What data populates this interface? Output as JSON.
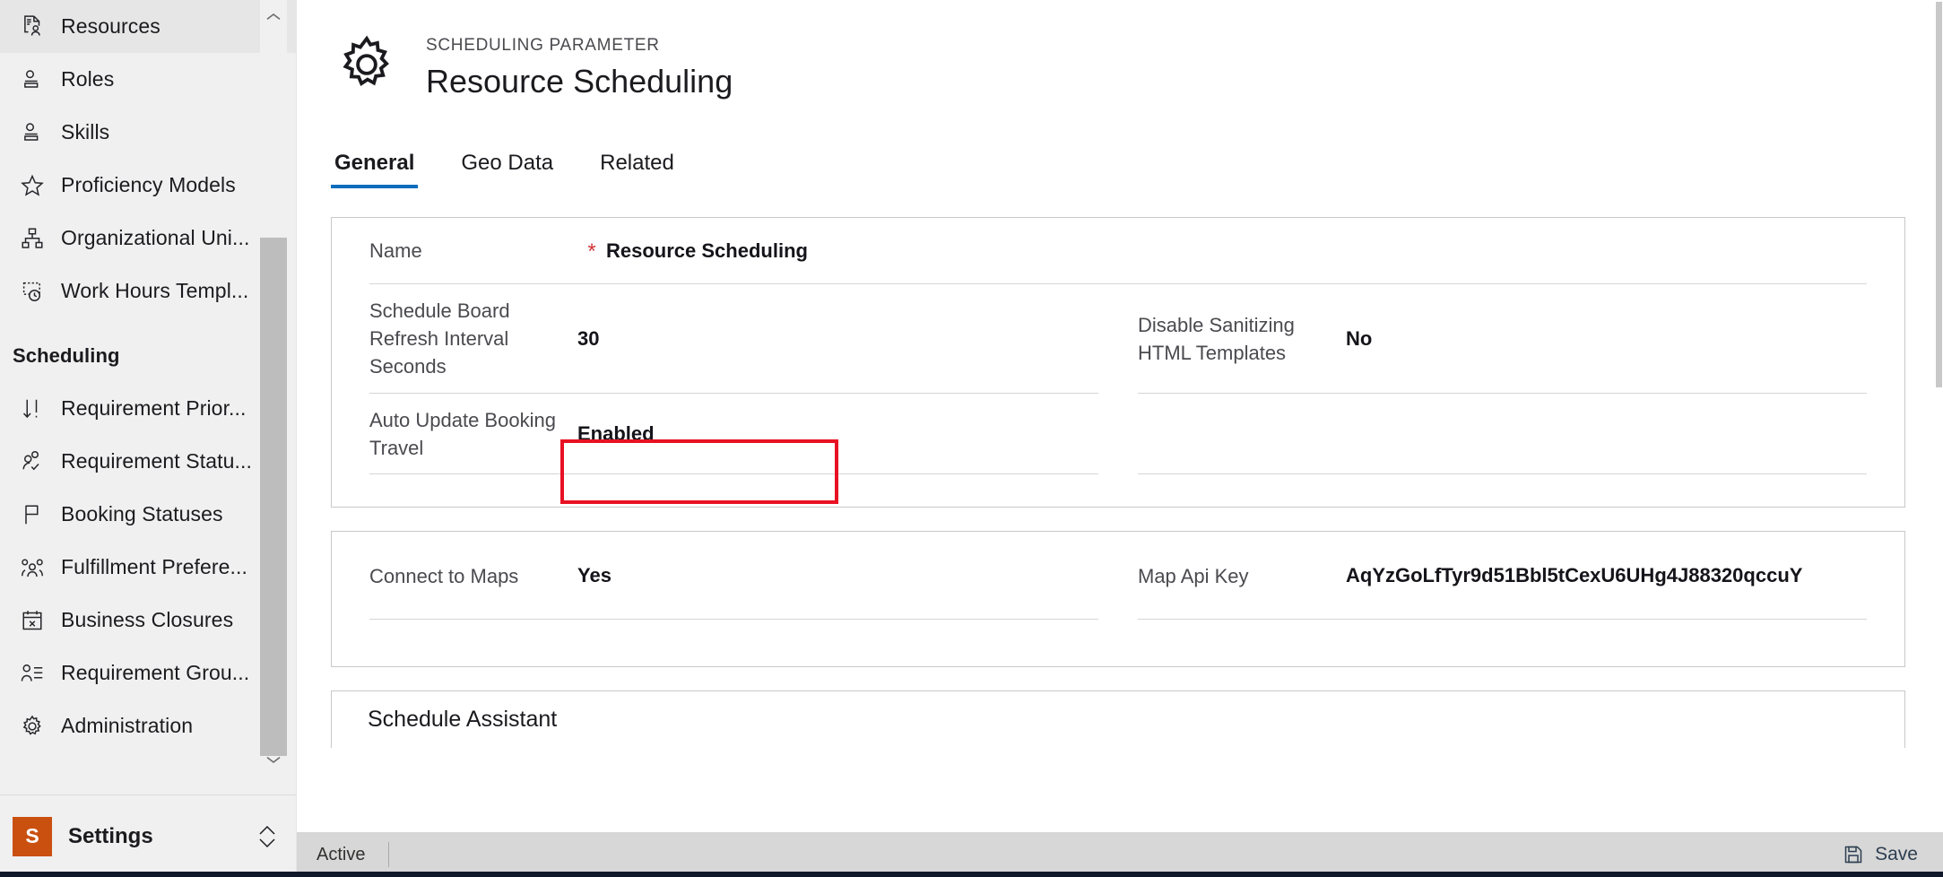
{
  "sidebar": {
    "items": [
      {
        "label": "Resources",
        "icon": "document-person-icon"
      },
      {
        "label": "Roles",
        "icon": "person-card-icon"
      },
      {
        "label": "Skills",
        "icon": "person-card-icon"
      },
      {
        "label": "Proficiency Models",
        "icon": "star-icon"
      },
      {
        "label": "Organizational Uni...",
        "icon": "org-hierarchy-icon"
      },
      {
        "label": "Work Hours Templ...",
        "icon": "clock-template-icon"
      }
    ],
    "group_title": "Scheduling",
    "group_items": [
      {
        "label": "Requirement Prior...",
        "icon": "sort-priority-icon"
      },
      {
        "label": "Requirement Statu...",
        "icon": "person-check-icon"
      },
      {
        "label": "Booking Statuses",
        "icon": "flag-icon"
      },
      {
        "label": "Fulfillment Prefere...",
        "icon": "people-group-icon"
      },
      {
        "label": "Business Closures",
        "icon": "calendar-x-icon"
      },
      {
        "label": "Requirement Grou...",
        "icon": "person-list-icon"
      },
      {
        "label": "Administration",
        "icon": "gear-icon"
      }
    ],
    "footer": {
      "badge": "S",
      "label": "Settings",
      "badge_color": "#ca5010",
      "chevron_icon": "chevron-updown-icon"
    },
    "scroll_up_icon": "chevron-up-icon",
    "scroll_down_icon": "chevron-down-icon"
  },
  "header": {
    "icon": "gear-icon",
    "eyebrow": "SCHEDULING PARAMETER",
    "title": "Resource Scheduling"
  },
  "tabs": [
    {
      "label": "General",
      "active": true
    },
    {
      "label": "Geo Data",
      "active": false
    },
    {
      "label": "Related",
      "active": false
    }
  ],
  "accent_color": "#0f6cbd",
  "highlight_color": "#e81123",
  "form": {
    "name_row": {
      "label": "Name",
      "required_marker": "*",
      "value": "Resource Scheduling"
    },
    "rows": [
      {
        "left": {
          "label": "Schedule Board Refresh Interval Seconds",
          "value": "30"
        },
        "right": {
          "label": "Disable Sanitizing HTML Templates",
          "value": "No"
        }
      },
      {
        "left": {
          "label": "Auto Update Booking Travel",
          "value": "Enabled",
          "highlighted": true
        },
        "right": {
          "label": "",
          "value": ""
        }
      }
    ],
    "maps_rows": [
      {
        "left": {
          "label": "Connect to Maps",
          "value": "Yes"
        },
        "right": {
          "label": "Map Api Key",
          "value": "AqYzGoLfTyr9d51Bbl5tCexU6UHg4J88320qccuY"
        }
      }
    ],
    "section": {
      "title": "Schedule Assistant"
    }
  },
  "statusbar": {
    "status": "Active",
    "save_label": "Save",
    "save_icon": "save-disk-icon"
  }
}
